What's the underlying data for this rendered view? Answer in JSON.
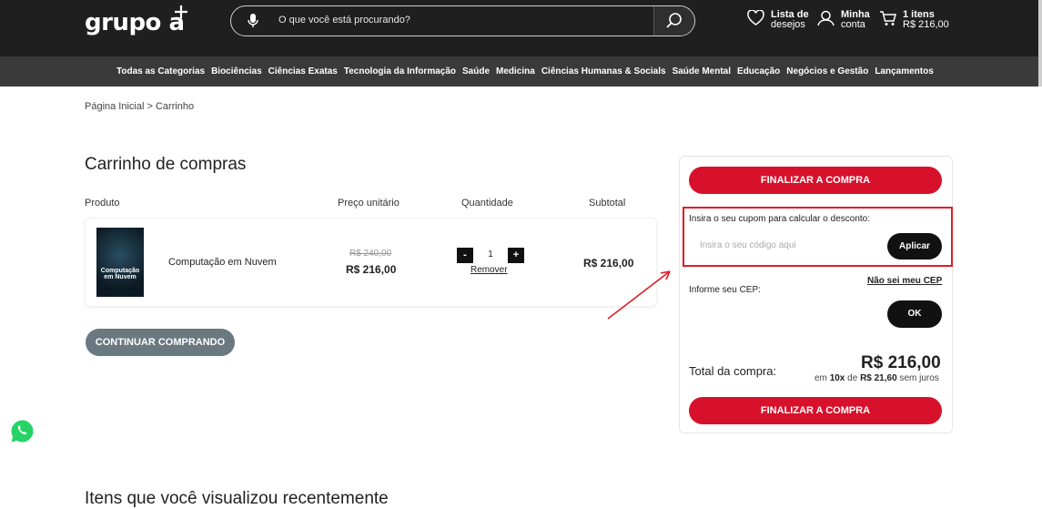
{
  "header": {
    "logo": "grupo a",
    "search_placeholder": "O que você está procurando?",
    "wishlist_line1": "Lista de",
    "wishlist_line2": "desejos",
    "account_line1": "Minha",
    "account_line2": "conta",
    "cart_line1": "1 itens",
    "cart_line2": "R$ 216,00"
  },
  "menu": [
    "Todas as Categorias",
    "Biociências",
    "Ciências Exatas",
    "Tecnologia da Informação",
    "Saúde",
    "Medicina",
    "Ciências Humanas & Socials",
    "Saúde Mental",
    "Educação",
    "Negócios e Gestão",
    "Lançamentos"
  ],
  "breadcrumb": "Página Inicial  >  Carrinho",
  "cart": {
    "title": "Carrinho de compras",
    "headers": {
      "product": "Produto",
      "unit_price": "Preço unitário",
      "quantity": "Quantidade",
      "subtotal": "Subtotal"
    },
    "item": {
      "cover_title": "Computação em Nuvem",
      "name": "Computação em Nuvem",
      "old_price": "R$ 240,00",
      "price": "R$ 216,00",
      "minus": "-",
      "qty": "1",
      "plus": "+",
      "remove": "Remover",
      "subtotal": "R$ 216,00"
    },
    "continue_button": "CONTINUAR COMPRANDO"
  },
  "summary": {
    "checkout_top": "FINALIZAR A COMPRA",
    "coupon_label": "Insira o seu cupom para calcular o desconto:",
    "coupon_placeholder": "Insira o seu código aqui",
    "coupon_apply": "Aplicar",
    "cep_link": "Não sei meu CEP",
    "cep_label": "Informe seu CEP:",
    "cep_button": "OK",
    "total_label": "Total da compra:",
    "total_value": "R$ 216,00",
    "installments_prefix": "em",
    "installments_count": "10x",
    "installments_mid": "de",
    "installments_value": "R$ 21,60",
    "installments_suffix": "sem juros",
    "checkout_bottom": "FINALIZAR A COMPRA"
  },
  "recent_title": "Itens que você visualizou recentemente",
  "colors": {
    "header": "#1f1f1f",
    "menubar": "#3a3a3a",
    "accent": "#d7112c",
    "highlight": "#e01d24"
  }
}
